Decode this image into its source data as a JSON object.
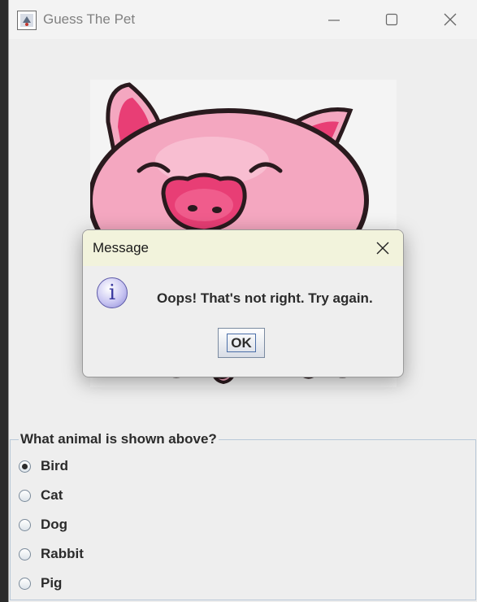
{
  "window": {
    "title": "Guess The Pet"
  },
  "image": {
    "subject": "pig",
    "colors": {
      "pink": "#f4a7c0",
      "dark_pink": "#e83e75",
      "outline": "#2a1a1e"
    }
  },
  "question": {
    "title": "What animal is shown above?",
    "options": [
      {
        "label": "Bird",
        "selected": true
      },
      {
        "label": "Cat",
        "selected": false
      },
      {
        "label": "Dog",
        "selected": false
      },
      {
        "label": "Rabbit",
        "selected": false
      },
      {
        "label": "Pig",
        "selected": false
      }
    ]
  },
  "dialog": {
    "title": "Message",
    "message": "Oops! That's not right. Try again.",
    "ok_label": "OK",
    "icon": "info-icon"
  }
}
